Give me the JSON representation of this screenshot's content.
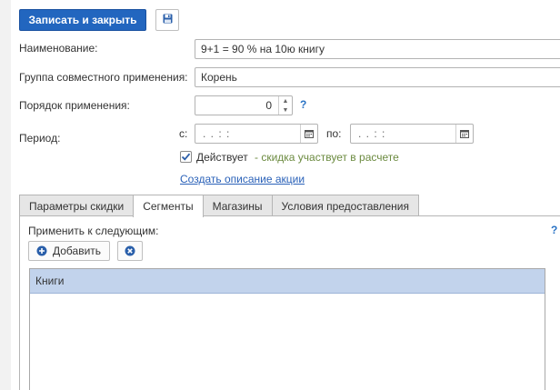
{
  "toolbar": {
    "save_close_label": "Записать и закрыть",
    "save_icon": "floppy-disk-icon"
  },
  "form": {
    "name_label": "Наименование:",
    "name_value": "9+1 = 90 % на 10ю книгу",
    "group_label": "Группа совместного применения:",
    "group_value": "Корень",
    "order_label": "Порядок применения:",
    "order_value": "0",
    "order_help": "?",
    "period_label": "Период:",
    "from_label": "с:",
    "from_value": ". .    : :",
    "to_label": "по:",
    "to_value": ". .    : :",
    "active_label": "Действует",
    "active_checked": true,
    "active_hint": "- скидка участвует в расчете",
    "create_desc_link": "Создать описание акции"
  },
  "tabs": [
    {
      "label": "Параметры скидки",
      "active": false
    },
    {
      "label": "Сегменты",
      "active": true
    },
    {
      "label": "Магазины",
      "active": false
    },
    {
      "label": "Условия предоставления",
      "active": false
    }
  ],
  "segments": {
    "apply_label": "Применить к следующим:",
    "help": "?",
    "add_label": "Добавить",
    "rows": [
      "Книги"
    ]
  },
  "colors": {
    "primary": "#2266bf",
    "link": "#2a61b8",
    "hint": "#6b8a3f",
    "selected_row": "#c2d3ec"
  }
}
